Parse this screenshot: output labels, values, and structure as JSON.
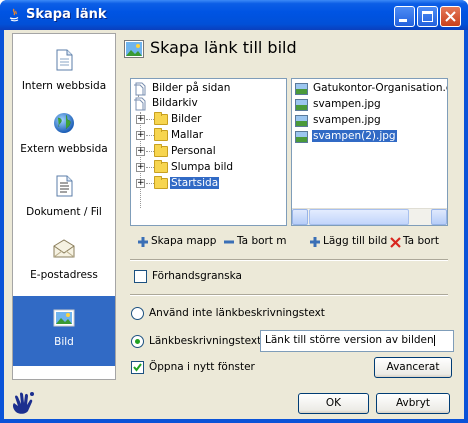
{
  "window": {
    "title": "Skapa länk",
    "controls": {
      "minimize": "minimize-icon",
      "maximize": "maximize-icon",
      "close": "close-icon"
    }
  },
  "sidebar": {
    "items": [
      {
        "label": "Intern webbsida",
        "icon": "page-icon"
      },
      {
        "label": "Extern webbsida",
        "icon": "globe-icon"
      },
      {
        "label": "Dokument / Fil",
        "icon": "document-icon"
      },
      {
        "label": "E-postadress",
        "icon": "envelope-icon"
      },
      {
        "label": "Bild",
        "icon": "picture-icon",
        "active": true
      }
    ]
  },
  "main": {
    "heading": "Skapa länk till bild",
    "tree": {
      "root": "Bilder på sidan",
      "archive": "Bildarkiv",
      "folders": [
        "Bilder",
        "Mallar",
        "Personal",
        "Slumpa bild",
        "Startsida"
      ],
      "selected": "Startsida"
    },
    "files": [
      "Gatukontor-Organisation.gif",
      "svampen.jpg",
      "svampen.jpg",
      "svampen(2).jpg"
    ],
    "selected_file": "svampen(2).jpg",
    "actions": {
      "create_folder": "Skapa mapp",
      "delete_folder": "Ta bort m",
      "add_image": "Lägg till bild",
      "delete_image": "Ta bort"
    },
    "preview_label": "Förhandsgranska",
    "preview_checked": false,
    "no_link_text_label": "Använd inte länkbeskrivningstext",
    "link_text_label": "Länkbeskrivningstext:",
    "link_text_value": "Länk till större version av bilden",
    "link_text_selected": true,
    "open_new_window_label": "Öppna i nytt fönster",
    "open_new_window_checked": true,
    "advanced_button": "Avancerat"
  },
  "footer": {
    "ok": "OK",
    "cancel": "Avbryt"
  },
  "colors": {
    "titlebar": "#0054e3",
    "selection": "#316ac5",
    "dialog_bg": "#ece9d8"
  }
}
